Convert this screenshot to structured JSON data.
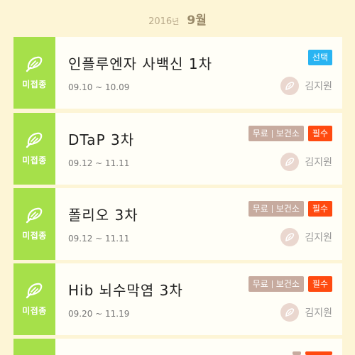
{
  "header": {
    "year": "2016",
    "year_unit": "년",
    "month": "9월"
  },
  "cards": [
    {
      "status": "미접종",
      "title": "인플루엔자 사백신 1차",
      "dates": "09.10 ~ 10.09",
      "badges": {
        "type": "선택"
      },
      "person": "김지원"
    },
    {
      "status": "미접종",
      "title": "DTaP 3차",
      "dates": "09.12 ~ 11.11",
      "badges": {
        "free": "무료",
        "center": "보건소",
        "type": "필수"
      },
      "person": "김지원"
    },
    {
      "status": "미접종",
      "title": "폴리오 3차",
      "dates": "09.12 ~ 11.11",
      "badges": {
        "free": "무료",
        "center": "보건소",
        "type": "필수"
      },
      "person": "김지원"
    },
    {
      "status": "미접종",
      "title": "Hib 뇌수막염 3차",
      "dates": "09.20 ~ 11.19",
      "badges": {
        "free": "무료",
        "center": "보건소",
        "type": "필수"
      },
      "person": "김지원"
    }
  ],
  "icons": {
    "status_icon": "vaccine-leaf-icon",
    "avatar_icon": "syringe-icon"
  },
  "colors": {
    "status_bg": "#a6e04a",
    "optional": "#29b4f2",
    "required": "#ff4a10",
    "free": "#c7ab9f",
    "background": "#fdf5d6"
  }
}
